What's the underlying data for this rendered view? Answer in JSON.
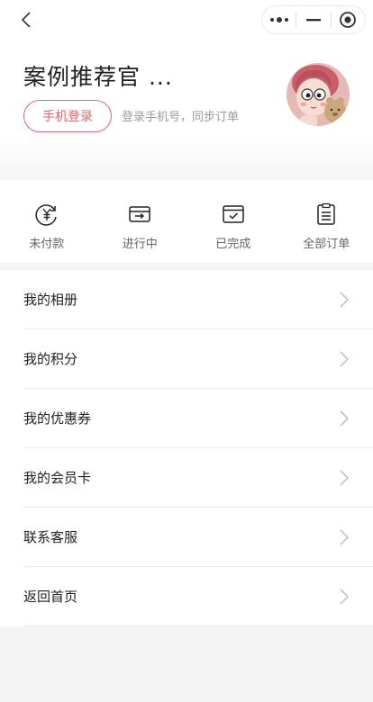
{
  "capsule": {
    "more_icon": "more-dots-icon",
    "minimize_icon": "minimize-icon",
    "close_icon": "target-close-icon"
  },
  "profile": {
    "nickname": "案例推荐官 ...",
    "login_button": "手机登录",
    "login_tip": "登录手机号，同步订单"
  },
  "orders": [
    {
      "label": "未付款",
      "icon": "unpaid-icon"
    },
    {
      "label": "进行中",
      "icon": "in-progress-icon"
    },
    {
      "label": "已完成",
      "icon": "completed-icon"
    },
    {
      "label": "全部订单",
      "icon": "all-orders-icon"
    }
  ],
  "menu": [
    {
      "label": "我的相册"
    },
    {
      "label": "我的积分"
    },
    {
      "label": "我的优惠券"
    },
    {
      "label": "我的会员卡"
    },
    {
      "label": "联系客服"
    },
    {
      "label": "返回首页"
    }
  ],
  "colors": {
    "accent": "#e0676c"
  }
}
